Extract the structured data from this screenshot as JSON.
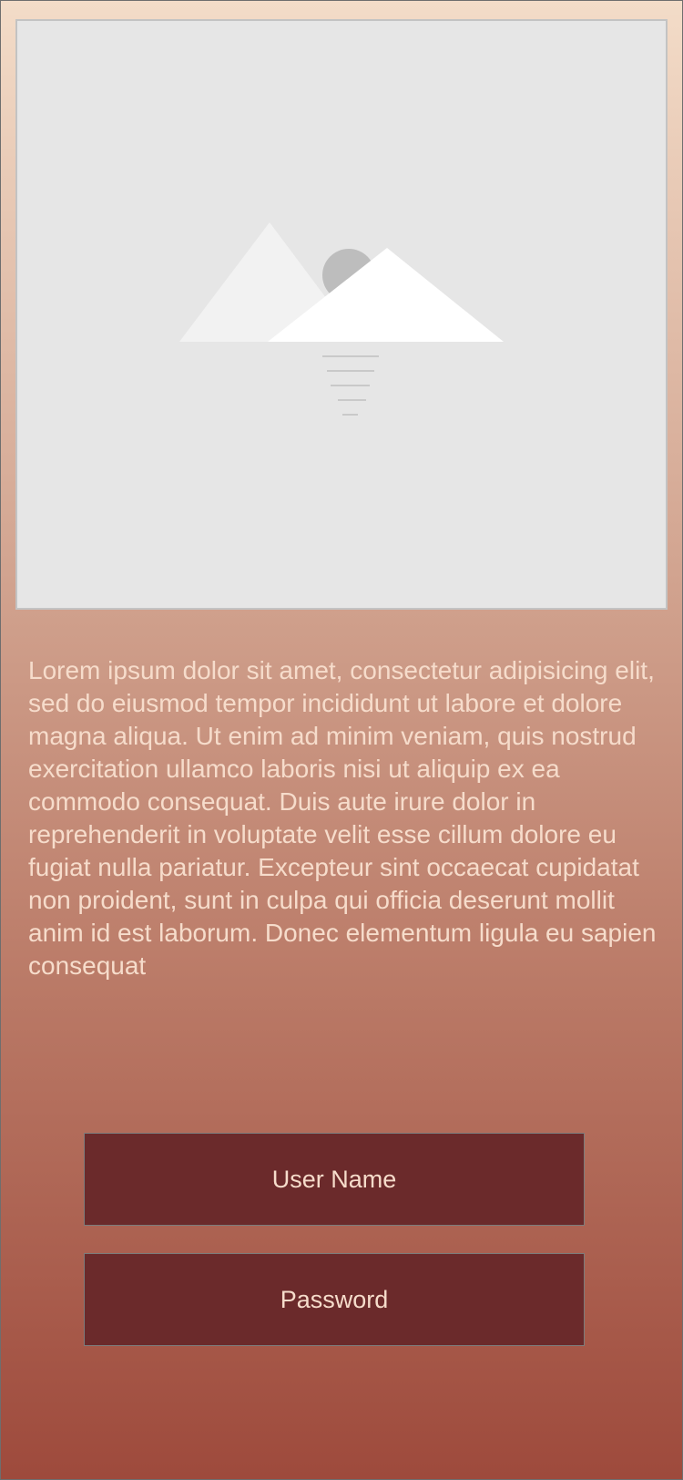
{
  "content": {
    "body_text": "Lorem ipsum dolor sit amet, consectetur adipisicing elit, sed do eiusmod tempor incididunt ut labore et dolore magna aliqua. Ut enim ad minim veniam, quis nostrud exercitation ullamco laboris nisi ut aliquip ex ea commodo consequat. Duis aute irure dolor in reprehenderit in voluptate velit esse cillum dolore eu fugiat nulla pariatur. Excepteur sint occaecat cupidatat non proident, sunt in culpa qui officia deserunt mollit anim id est laborum. Donec elementum ligula eu sapien consequat"
  },
  "login": {
    "username_placeholder": "User Name",
    "password_placeholder": "Password"
  },
  "colors": {
    "gradient_top": "#f3dcc8",
    "gradient_bottom": "#9e4a3c",
    "field_background": "#6b2a2b",
    "text_light": "#f6dccb",
    "placeholder_background": "#e6e6e6"
  },
  "icons": {
    "image_placeholder": "landscape-placeholder-icon"
  }
}
